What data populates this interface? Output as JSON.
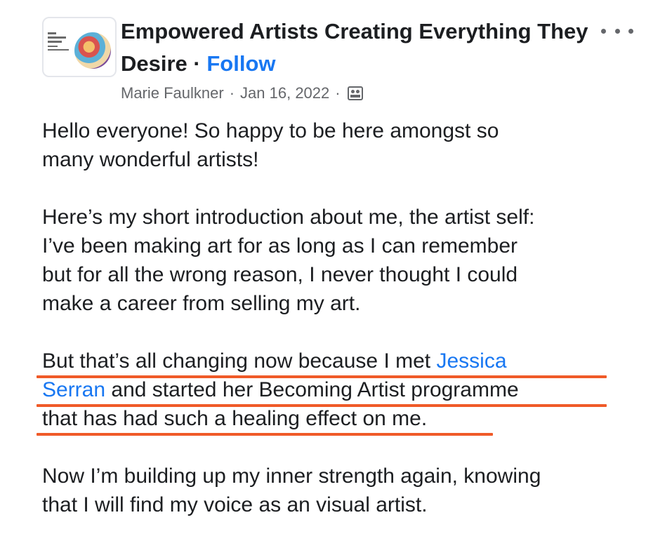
{
  "post": {
    "group_name": "Empowered Artists Creating Everything They Desire",
    "separator": " · ",
    "follow_label": "Follow",
    "author": "Marie Faulkner",
    "date": "Jan 16, 2022",
    "meta_separator": "·",
    "avatar_label": "The BECOMING ARTIST",
    "paragraphs": [
      "Hello everyone! So happy to be here amongst so\nmany wonderful artists!",
      "Here’s my short introduction about me, the artist self:\nI’ve been making art for as long as I can remember\nbut for all the wrong reason, I never thought I could\nmake a career from selling my art.",
      "Now I’m building up my inner strength again, knowing\nthat I will find my voice as an visual artist."
    ],
    "highlight_paragraph": {
      "before": "But that’s all changing now because I met ",
      "mention": "Jessica\nSerran",
      "after": " and started her Becoming Artist programme\nthat has had such a healing effect on me."
    }
  },
  "colors": {
    "link": "#1877f2",
    "text": "#1c1e21",
    "meta": "#65676b",
    "highlight": "#f05a28"
  },
  "icons": {
    "more": "more-horizontal-icon",
    "audience": "group-audience-icon"
  }
}
